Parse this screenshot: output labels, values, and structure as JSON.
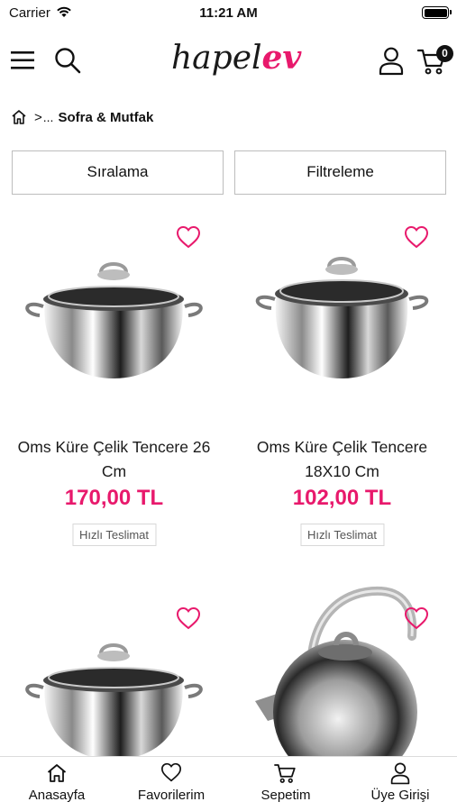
{
  "status_bar": {
    "carrier": "Carrier",
    "time": "11:21 AM"
  },
  "header": {
    "logo_part1": "hapel",
    "logo_part2": "ev",
    "cart_count": "0",
    "icons": [
      "menu-icon",
      "search-icon",
      "user-icon",
      "cart-icon"
    ]
  },
  "breadcrumb": {
    "separator": ">",
    "ellipsis": "...",
    "current": "Sofra & Mutfak"
  },
  "controls": {
    "sort_label": "Sıralama",
    "filter_label": "Filtreleme"
  },
  "products": [
    {
      "name": "Oms Küre Çelik Tencere 26 Cm",
      "price": "170,00 TL",
      "badge": "Hızlı Teslimat",
      "image": "pot"
    },
    {
      "name": "Oms Küre Çelik Tencere 18X10 Cm",
      "price": "102,00 TL",
      "badge": "Hızlı Teslimat",
      "image": "pot"
    },
    {
      "image": "pot"
    },
    {
      "image": "kettle"
    }
  ],
  "tab_bar": {
    "home": "Anasayfa",
    "favorites": "Favorilerim",
    "cart": "Sepetim",
    "account": "Üye Girişi"
  },
  "colors": {
    "accent": "#e8196c",
    "text": "#111111",
    "border": "#bdbdbd"
  }
}
